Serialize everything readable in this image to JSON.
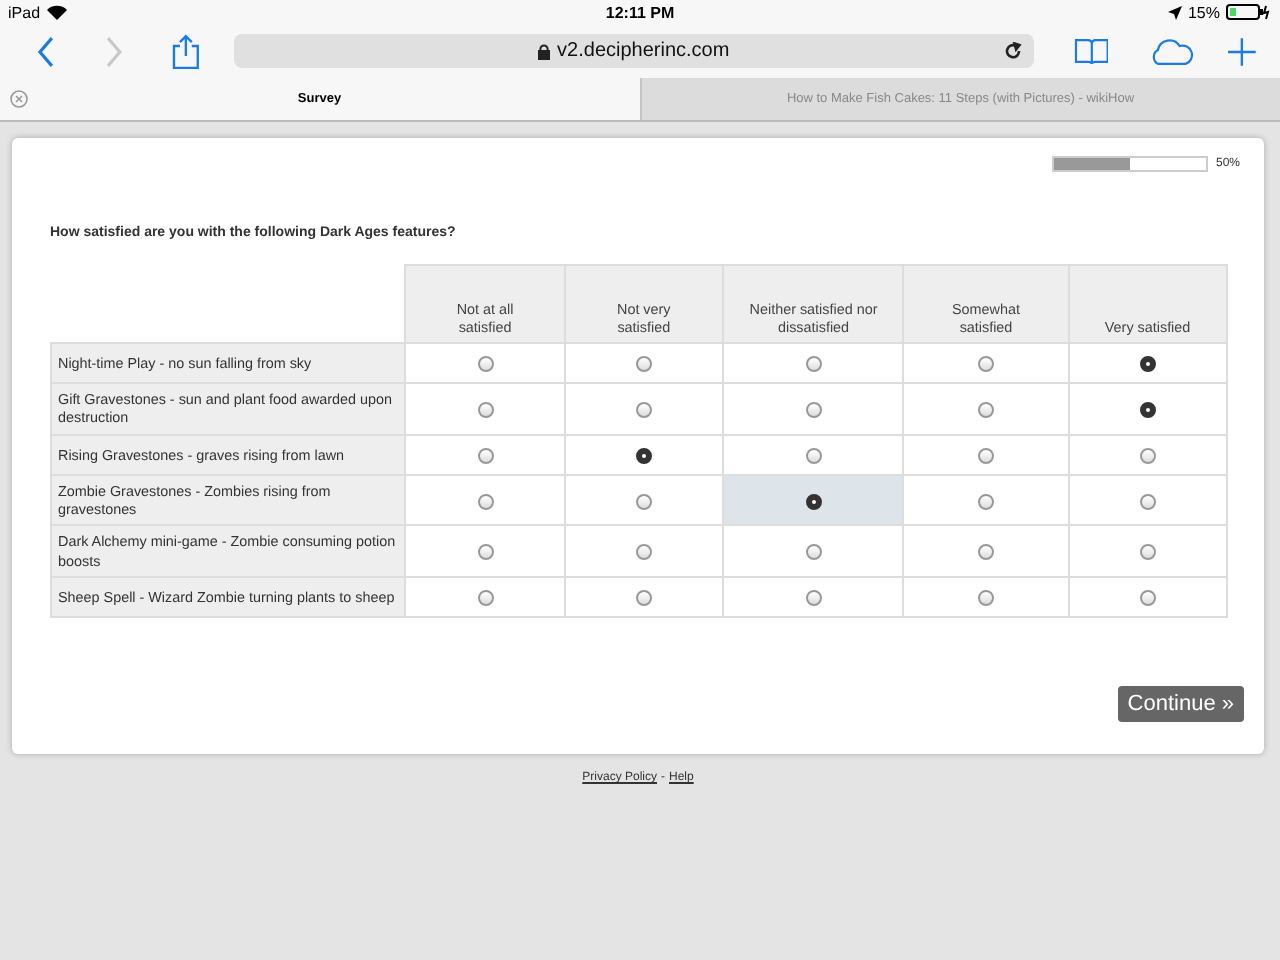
{
  "status_bar": {
    "device": "iPad",
    "time": "12:11 PM",
    "battery": "15%"
  },
  "toolbar": {
    "back_disabled": false,
    "forward_disabled": true,
    "address": "v2.decipherinc.com"
  },
  "tabs": [
    {
      "label": "Survey",
      "selected": true
    },
    {
      "label": "How to Make Fish Cakes: 11 Steps (with Pictures) - wikiHow",
      "selected": false
    }
  ],
  "survey": {
    "progress": {
      "level": 0.5,
      "reading": "50%"
    },
    "question": "How satisfied are you with the following Dark Ages features?",
    "columns": [
      "Not at all satisfied",
      "Not very satisfied",
      "Neither satisfied nor dissatisfied",
      "Somewhat satisfied",
      "Very satisfied"
    ],
    "rows": [
      {
        "label": "Night-time Play - no sun falling from sky",
        "highlighted": false,
        "choices": [
          {
            "selected": false
          },
          {
            "selected": false
          },
          {
            "selected": false
          },
          {
            "selected": false
          },
          {
            "selected": true
          }
        ]
      },
      {
        "label": "Gift Gravestones - sun and plant food awarded upon destruction",
        "highlighted": false,
        "choices": [
          {
            "selected": false
          },
          {
            "selected": false
          },
          {
            "selected": false
          },
          {
            "selected": false
          },
          {
            "selected": true
          }
        ]
      },
      {
        "label": "Rising Gravestones  - graves rising from lawn",
        "highlighted": false,
        "choices": [
          {
            "selected": false
          },
          {
            "selected": true
          },
          {
            "selected": false
          },
          {
            "selected": false
          },
          {
            "selected": false
          }
        ]
      },
      {
        "label": "Zombie Gravestones - Zombies rising from gravestones",
        "highlighted": true,
        "choices": [
          {
            "selected": false
          },
          {
            "selected": false
          },
          {
            "selected": true
          },
          {
            "selected": false
          },
          {
            "selected": false
          }
        ]
      },
      {
        "label": "Dark Alchemy mini-game - Zombie consuming potion boosts",
        "highlighted": false,
        "choices": [
          {
            "selected": false
          },
          {
            "selected": false
          },
          {
            "selected": false
          },
          {
            "selected": false
          },
          {
            "selected": false
          }
        ]
      },
      {
        "label": "Sheep Spell - Wizard Zombie turning plants to sheep",
        "highlighted": false,
        "choices": [
          {
            "selected": false
          },
          {
            "selected": false
          },
          {
            "selected": false
          },
          {
            "selected": false
          },
          {
            "selected": false
          }
        ]
      }
    ],
    "continue_button": "Continue »"
  },
  "footer": {
    "links": [
      "Privacy Policy",
      "Help"
    ],
    "separator": "-"
  }
}
